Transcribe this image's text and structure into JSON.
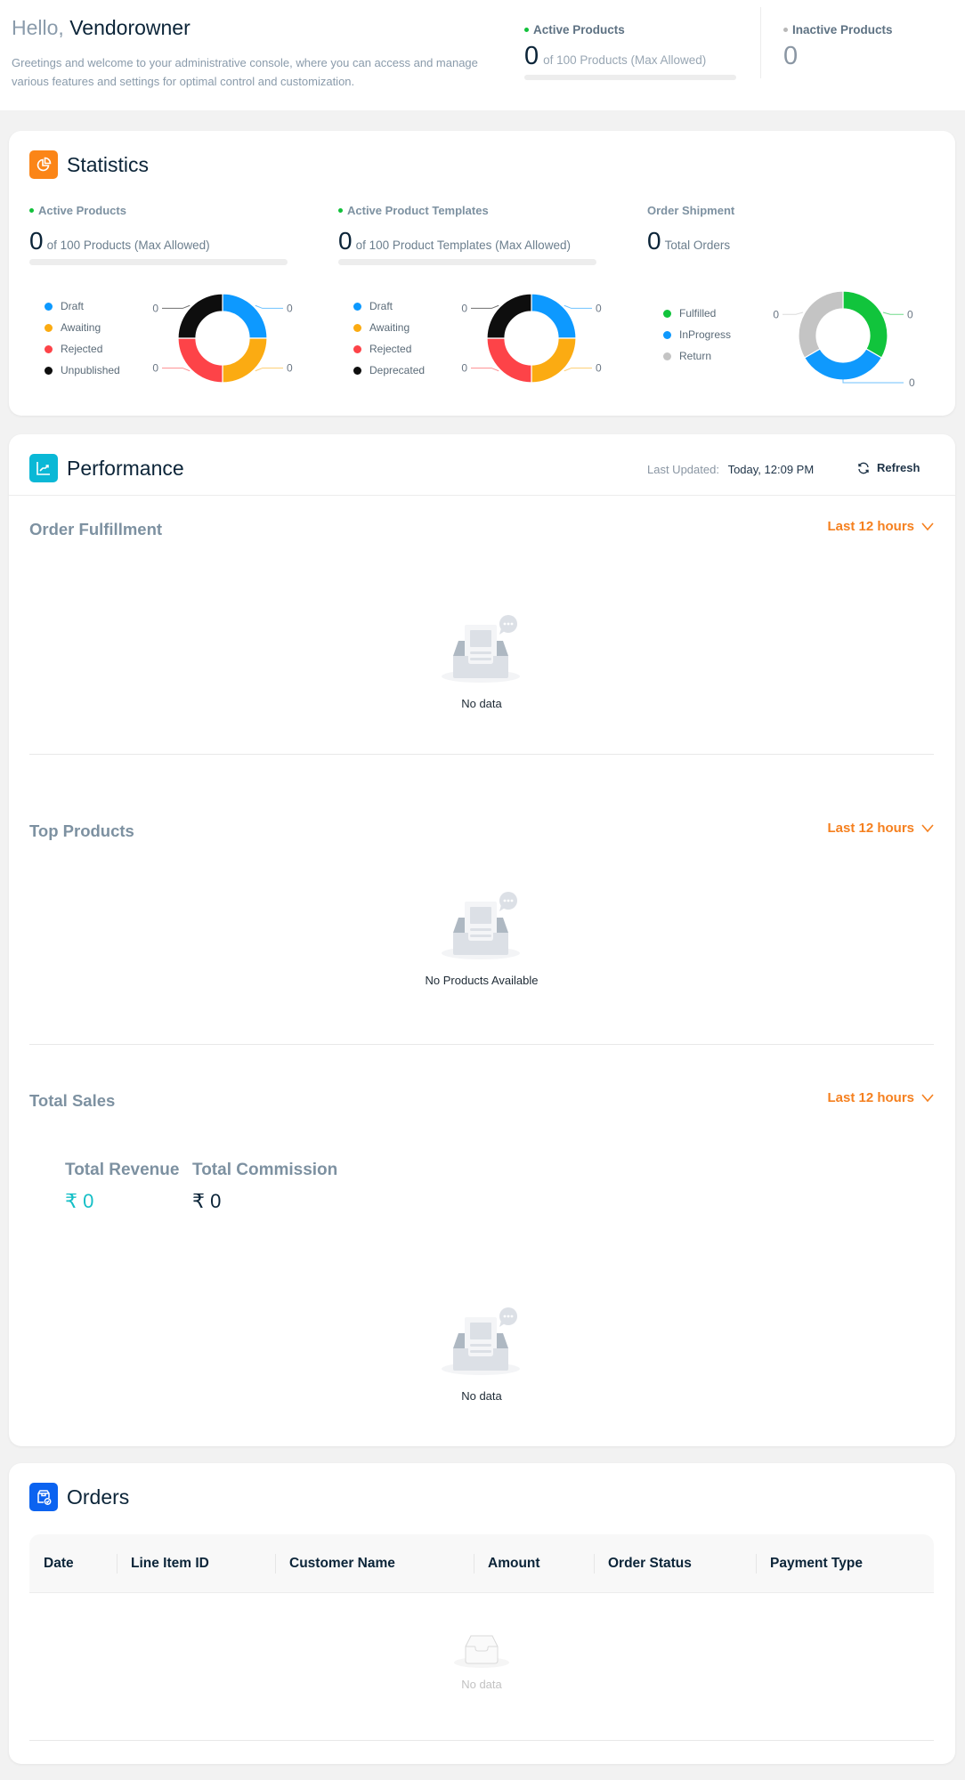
{
  "header": {
    "greeting": "Hello,",
    "user_name": "Vendorowner",
    "intro": "Greetings and welcome to your administrative console, where you can access and manage various features and settings for optimal control and customization.",
    "active_products": {
      "label": "Active Products",
      "value": "0",
      "sub": "of 100 Products (Max Allowed)",
      "progress_fraction": 0,
      "dot_color": "#12c13b"
    },
    "inactive_products": {
      "label": "Inactive Products",
      "value": "0",
      "dot_color": "#b8b8b8"
    }
  },
  "statistics": {
    "title": "Statistics",
    "icon": "pie-chart-icon",
    "icon_bg": "#fb8517",
    "active_products": {
      "label": "Active Products",
      "value": "0",
      "sub": "of 100 Products (Max Allowed)",
      "progress_fraction": 0,
      "legend": [
        "Draft",
        "Awaiting",
        "Rejected",
        "Unpublished"
      ]
    },
    "active_templates": {
      "label": "Active Product Templates",
      "value": "0",
      "sub": "of 100 Product Templates (Max Allowed)",
      "progress_fraction": 0,
      "legend": [
        "Draft",
        "Awaiting",
        "Rejected",
        "Deprecated"
      ]
    },
    "order_shipment": {
      "label": "Order Shipment",
      "value": "0",
      "sub": "Total Orders",
      "legend": [
        "Fulfilled",
        "InProgress",
        "Return"
      ]
    }
  },
  "chart_data": [
    {
      "type": "pie",
      "title": "Active Products",
      "categories": [
        "Draft",
        "Awaiting",
        "Rejected",
        "Unpublished"
      ],
      "values": [
        0,
        0,
        0,
        0
      ],
      "colors": [
        "#0d99ff",
        "#fbab12",
        "#fd4348",
        "#0e0e0e"
      ],
      "donut": true,
      "legend": "left"
    },
    {
      "type": "pie",
      "title": "Active Product Templates",
      "categories": [
        "Draft",
        "Awaiting",
        "Rejected",
        "Deprecated"
      ],
      "values": [
        0,
        0,
        0,
        0
      ],
      "colors": [
        "#0d99ff",
        "#fbab12",
        "#fd4348",
        "#0e0e0e"
      ],
      "donut": true,
      "legend": "left"
    },
    {
      "type": "pie",
      "title": "Order Shipment",
      "categories": [
        "Fulfilled",
        "InProgress",
        "Return"
      ],
      "values": [
        0,
        0,
        0
      ],
      "colors": [
        "#11c43c",
        "#0f99fd",
        "#c4c4c4"
      ],
      "donut": true,
      "legend": "left"
    }
  ],
  "performance": {
    "title": "Performance",
    "icon": "line-chart-icon",
    "icon_bg": "#0ab8d6",
    "last_updated_label": "Last Updated:",
    "last_updated_value": "Today, 12:09 PM",
    "refresh_label": "Refresh",
    "order_fulfillment": {
      "title": "Order Fulfillment",
      "range": "Last 12 hours",
      "empty_text": "No data"
    },
    "top_products": {
      "title": "Top Products",
      "range": "Last 12 hours",
      "empty_text": "No Products Available"
    },
    "total_sales": {
      "title": "Total Sales",
      "range": "Last 12 hours",
      "revenue_label": "Total Revenue",
      "revenue_value": "₹ 0",
      "commission_label": "Total Commission",
      "commission_value": "₹ 0",
      "empty_text": "No data"
    }
  },
  "orders": {
    "title": "Orders",
    "icon": "package-check-icon",
    "icon_bg": "#0b63f0",
    "columns": [
      "Date",
      "Line Item ID",
      "Customer Name",
      "Amount",
      "Order Status",
      "Payment Type"
    ],
    "rows": [],
    "empty_text": "No data"
  },
  "colors": {
    "accent_orange": "#f5801f",
    "revenue_teal": "#14bfc6"
  }
}
